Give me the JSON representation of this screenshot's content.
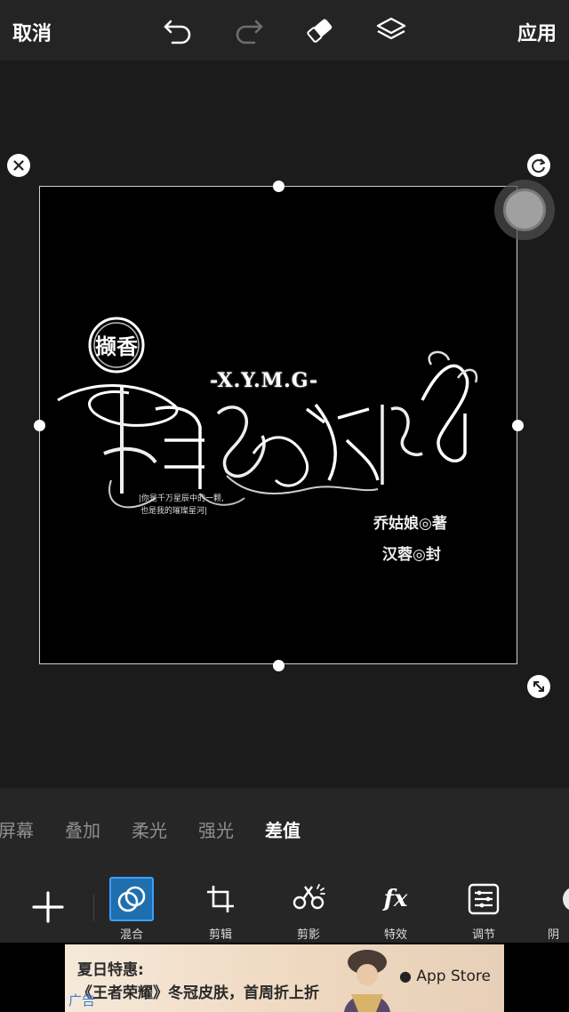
{
  "topbar": {
    "cancel_label": "取消",
    "apply_label": "应用",
    "icons": [
      "undo-icon",
      "redo-icon",
      "eraser-icon",
      "layers-icon"
    ]
  },
  "artwork": {
    "badge_text": "撷香",
    "title_text": "-X.Y.M.G-",
    "main_script": "相爱我相",
    "tagline_1": "|你是千万星辰中的一颗,",
    "tagline_2": "也是我的璀璨星河|",
    "signature_1": "乔姑娘◎著",
    "signature_2": "汉蓉◎封"
  },
  "blend_modes": {
    "items": [
      "屏幕",
      "叠加",
      "柔光",
      "强光",
      "差值"
    ],
    "active": "差值"
  },
  "tools": {
    "items": [
      {
        "label": "混合",
        "icon": "blend-icon",
        "active": true
      },
      {
        "label": "剪辑",
        "icon": "crop-icon",
        "active": false
      },
      {
        "label": "剪影",
        "icon": "cutout-icon",
        "active": false
      },
      {
        "label": "特效",
        "icon": "fx-icon",
        "active": false
      },
      {
        "label": "调节",
        "icon": "adjust-icon",
        "active": false
      },
      {
        "label": "阴",
        "icon": "shadow-icon",
        "active": false
      }
    ]
  },
  "ad": {
    "line1": "夏日特惠:",
    "line2": "《王者荣耀》冬冠皮肤，首周折上折",
    "tag": "广告",
    "store": "App Store"
  },
  "colors": {
    "accent": "#1f6fae",
    "accent_border": "#3aa0ff",
    "background": "#1b1b1c",
    "panel": "#262627"
  }
}
